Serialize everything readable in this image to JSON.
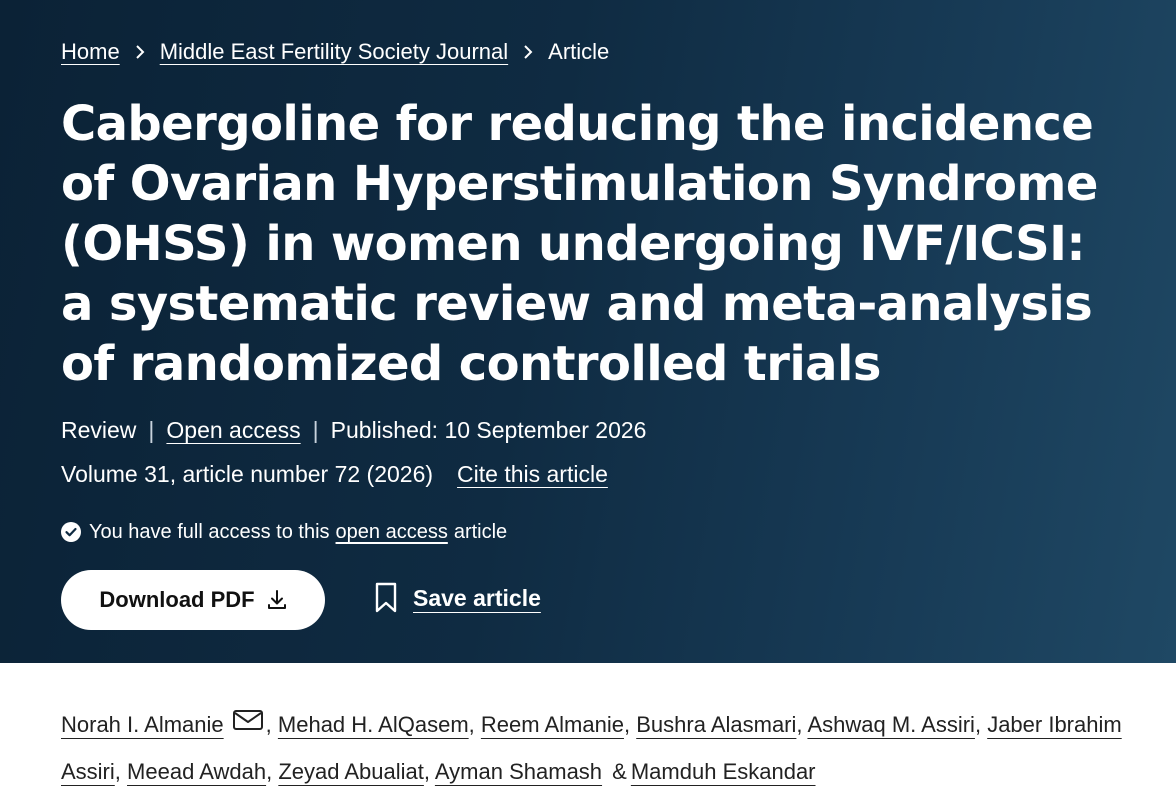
{
  "breadcrumb": {
    "home": "Home",
    "journal": "Middle East Fertility Society Journal",
    "current": "Article"
  },
  "article": {
    "title": "Cabergoline for reducing the incidence of Ovarian Hyperstimulation Syndrome (OHSS) in women undergoing IVF/ICSI: a systematic review and meta-analysis of randomized controlled trials",
    "type": "Review",
    "access": "Open access",
    "published": "Published: 10 September 2026",
    "volume": "Volume 31, article number 72 (2026)",
    "cite": "Cite this article"
  },
  "access_notice": {
    "prefix": "You have full access to this",
    "link": "open access",
    "suffix": "article"
  },
  "actions": {
    "download": "Download PDF",
    "save": "Save article"
  },
  "authors": [
    "Norah I. Almanie",
    "Mehad H. AlQasem",
    "Reem Almanie",
    "Bushra Alasmari",
    "Ashwaq M. Assiri",
    "Jaber Ibrahim Assiri",
    "Meead Awdah",
    "Zeyad Abualiat",
    "Ayman Shamash",
    "Mamduh Eskandar"
  ],
  "authors_separator": ",",
  "authors_last_joiner": "&",
  "icons": {
    "breadcrumb_separator": "chevron-right-icon",
    "access": "check-circle-icon",
    "download": "download-icon",
    "save": "bookmark-icon",
    "contact": "mail-icon"
  },
  "colors": {
    "hero_bg": "#0f2b42",
    "hero_text": "#ffffff",
    "button_bg": "#ffffff",
    "body_text": "#222222"
  }
}
